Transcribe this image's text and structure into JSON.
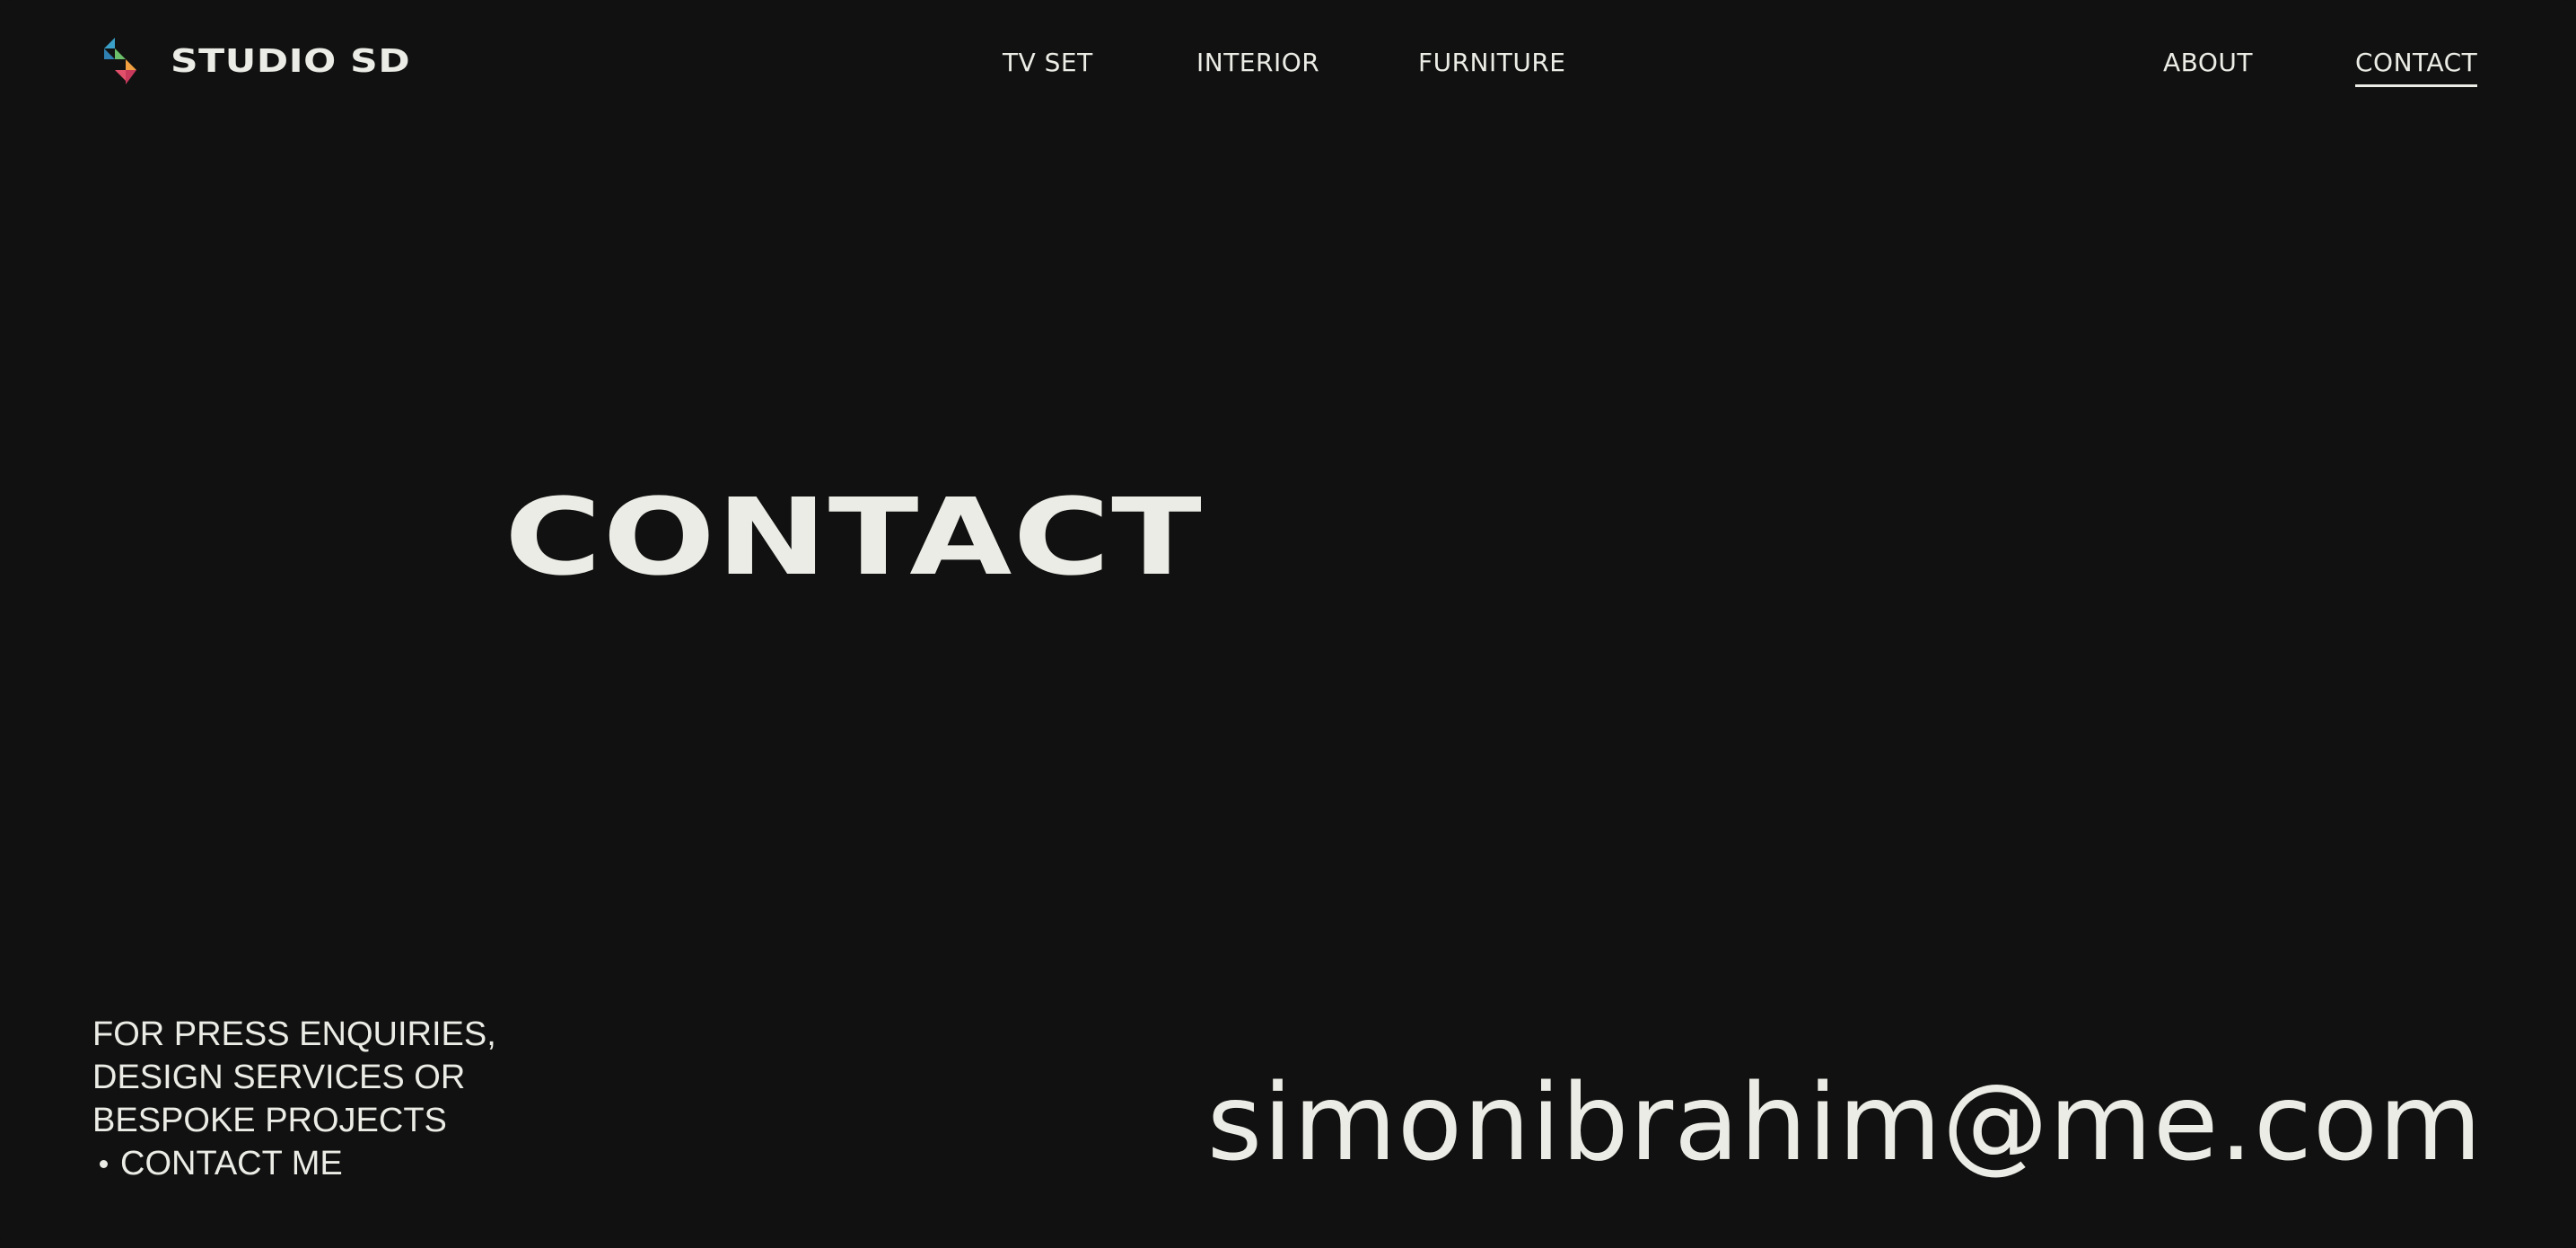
{
  "header": {
    "logo_text": "STUDIO SD",
    "logo_colors": [
      "#3aa0c8",
      "#6bbf6a",
      "#e0506a",
      "#f0a040"
    ],
    "nav_center": [
      {
        "label": "TV SET"
      },
      {
        "label": "INTERIOR"
      },
      {
        "label": "FURNITURE"
      }
    ],
    "nav_right": [
      {
        "label": "ABOUT"
      },
      {
        "label": "CONTACT",
        "active": true
      }
    ]
  },
  "hero": {
    "title": "CONTACT"
  },
  "enquiry": {
    "lines": [
      "FOR PRESS ENQUIRIES,",
      "DESIGN SERVICES OR",
      "BESPOKE PROJECTS"
    ],
    "cta_label": "CONTACT ME"
  },
  "email": "simonibrahim@me.com",
  "colors": {
    "background": "#111111",
    "text": "#ecece6"
  }
}
